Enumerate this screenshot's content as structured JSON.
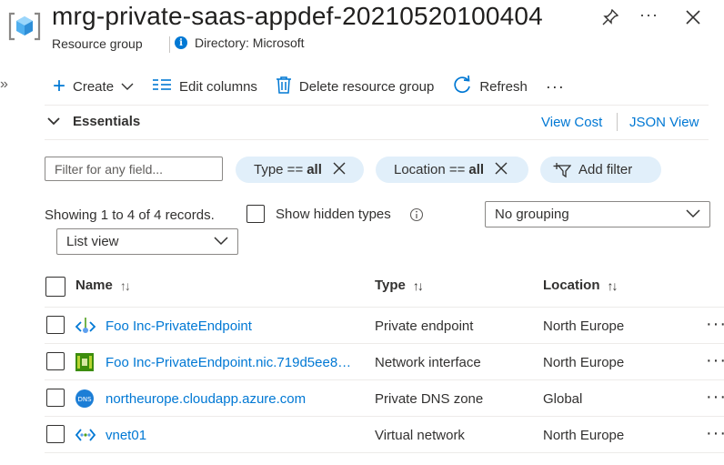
{
  "header": {
    "title": "mrg-private-saas-appdef-20210520100404",
    "subtitle": "Resource group",
    "directory": "Directory: Microsoft"
  },
  "left_rail": {
    "expand": "»"
  },
  "toolbar": {
    "create": "Create",
    "edit_columns": "Edit columns",
    "delete": "Delete resource group",
    "refresh": "Refresh",
    "more": "···"
  },
  "essentials": {
    "label": "Essentials",
    "view_cost": "View Cost",
    "json_view": "JSON View"
  },
  "filters": {
    "placeholder": "Filter for any field...",
    "type_label": "Type ==",
    "type_value": "all",
    "location_label": "Location ==",
    "location_value": "all",
    "add_filter": "Add filter"
  },
  "records": {
    "showing": "Showing 1 to 4 of 4 records.",
    "show_hidden": "Show hidden types",
    "grouping": "No grouping",
    "view": "List view"
  },
  "table": {
    "columns": {
      "name": "Name",
      "type": "Type",
      "location": "Location"
    },
    "rows": [
      {
        "name": "Foo Inc-PrivateEndpoint",
        "type": "Private endpoint",
        "location": "North Europe",
        "icon": "private-endpoint-icon"
      },
      {
        "name": "Foo Inc-PrivateEndpoint.nic.719d5ee8…",
        "type": "Network interface",
        "location": "North Europe",
        "icon": "network-interface-icon"
      },
      {
        "name": "northeurope.cloudapp.azure.com",
        "type": "Private DNS zone",
        "location": "Global",
        "icon": "dns-zone-icon"
      },
      {
        "name": "vnet01",
        "type": "Virtual network",
        "location": "North Europe",
        "icon": "virtual-network-icon"
      }
    ]
  },
  "colors": {
    "accent": "#0078d4",
    "pill_bg": "#e1effa"
  }
}
